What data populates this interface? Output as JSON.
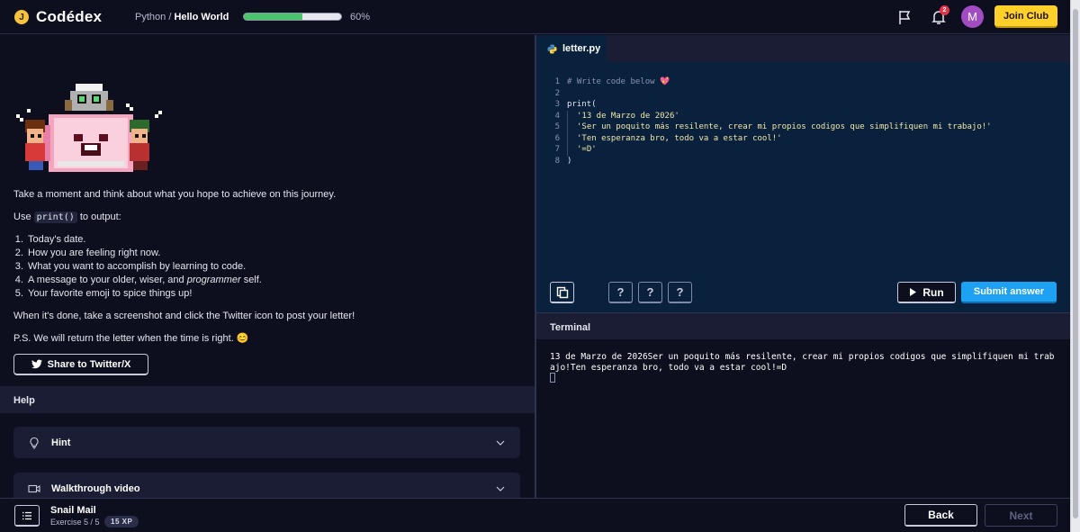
{
  "header": {
    "logo_letter": "J",
    "brand": "Codédex",
    "course": "Python",
    "separator": "/",
    "lesson": "Hello World",
    "progress": 0.6,
    "progress_label": "60%",
    "notification_count": "2",
    "avatar_initial": "M",
    "join_label": "Join Club",
    "icons": [
      "flag-icon",
      "bell-icon"
    ]
  },
  "lesson": {
    "intro": "Take a moment and think about what you hope to achieve on this journey.",
    "use_prefix": "Use",
    "use_code": "print()",
    "use_suffix": "to output:",
    "steps": [
      "Today's date.",
      "How you are feeling right now.",
      "What you want to accomplish by learning to code.",
      "A message to your older, wiser, and",
      "Your favorite emoji to spice things up!"
    ],
    "step4_em": "programmer",
    "step4_tail": "self.",
    "instruction": "When it's done, take a screenshot and click the Twitter icon to post your letter!",
    "ps": "P.S. We will return the letter when the time is right. 😊",
    "share_label": "Share to Twitter/X"
  },
  "help": {
    "title": "Help",
    "hint_label": "Hint",
    "video_label": "Walkthrough video"
  },
  "editor": {
    "filename": "letter.py",
    "lines": [
      {
        "n": "1",
        "text": "# Write code below 💖",
        "kind": "comment"
      },
      {
        "n": "2",
        "text": "",
        "kind": "plain"
      },
      {
        "n": "3",
        "text": "print(",
        "kind": "plain"
      },
      {
        "n": "4",
        "text": "'13 de Marzo de 2026'",
        "kind": "str"
      },
      {
        "n": "5",
        "text": "'Ser un poquito más resilente, crear mi propios codigos que simplifiquen mi trabajo!'",
        "kind": "str"
      },
      {
        "n": "6",
        "text": "'Ten esperanza bro, todo va a estar cool!'",
        "kind": "str"
      },
      {
        "n": "7",
        "text": "'=D'",
        "kind": "str"
      },
      {
        "n": "8",
        "text": ")",
        "kind": "plain"
      }
    ],
    "question_label": "?",
    "run_label": "Run",
    "submit_label": "Submit answer"
  },
  "terminal": {
    "title": "Terminal",
    "output": "13 de Marzo de 2026Ser un poquito más resilente, crear mi propios codigos que simplifiquen mi trabajo!Ten esperanza bro, todo va a estar cool!=D"
  },
  "footer": {
    "exercise_title": "Snail Mail",
    "exercise_sub": "Exercise 5 / 5",
    "xp": "15 XP",
    "back_label": "Back",
    "next_label": "Next"
  },
  "colors": {
    "bg": "#0e0f1e",
    "editor_bg": "#09213d",
    "accent_yellow": "#ffd02a",
    "accent_blue": "#1da1f2",
    "progress_green": "#48c46a"
  }
}
